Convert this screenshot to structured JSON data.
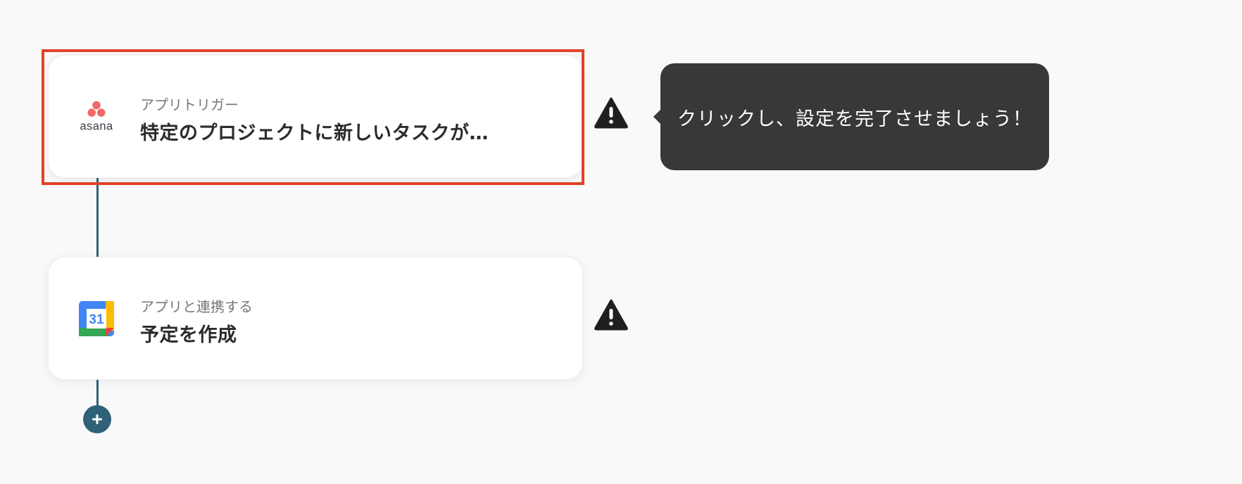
{
  "flow": {
    "steps": [
      {
        "type_label": "アプリトリガー",
        "title": "特定のプロジェクトに新しいタスクが…",
        "app": "asana",
        "icon": "asana-logo-icon",
        "status_icon": "warning-icon",
        "highlighted": true
      },
      {
        "type_label": "アプリと連携する",
        "title": "予定を作成",
        "app": "google-calendar",
        "icon": "google-calendar-icon",
        "calendar_day": "31",
        "status_icon": "warning-icon",
        "highlighted": false
      }
    ],
    "tooltip": "クリックし、設定を完了させましょう！",
    "add_step_icon": "plus-icon"
  },
  "colors": {
    "background": "#f9f9f9",
    "highlight_border": "#e0432a",
    "connector": "#2f6178",
    "tooltip_bg": "#383838",
    "asana_coral": "#f06a6a",
    "gcal_blue": "#4285f4",
    "gcal_green": "#34a853",
    "gcal_yellow": "#fbbc04",
    "gcal_red": "#ea4335"
  }
}
